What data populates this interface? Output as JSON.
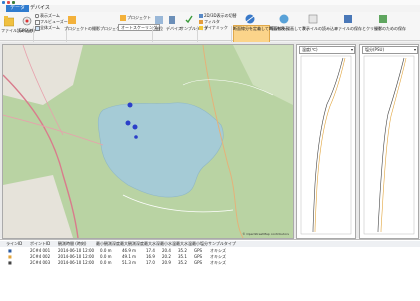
{
  "menu": {
    "items": [
      {
        "label": "データ",
        "active": true
      },
      {
        "label": "デバイス",
        "active": false
      }
    ]
  },
  "ribbon": {
    "buttons": {
      "file_input": "ファイル読み込み",
      "gps_output": "GPS出力",
      "zoom_in": "表示ズーム",
      "zoom_full": "フルビューズーム",
      "zoom_all": "全体ズーム",
      "project": "プロジェクトの撮影プロジェクトを確認する",
      "project_btn": "プロジェクト",
      "unit": "単位",
      "device": "デバイス",
      "sample_type": "サンプルタイプ",
      "select_combo": "オートスケーリング",
      "display_profile": "2D/3D表示の切替",
      "filter": "フィルタ",
      "wrap": "ダイナミック",
      "line_profile": "断面線分を定義して断面を表示",
      "contour": "等深線を描画して表示",
      "file_load": "ファイルの読み込み",
      "file_save": "ファイルの保存とクリック",
      "graph_save": "撮影のための保存"
    },
    "sections": [
      "表示",
      "プロジェクト",
      "フィルタ",
      "ツール",
      "ダウン"
    ]
  },
  "map": {
    "icon_labels": [
      "map-marker"
    ],
    "attribution": "© OpenStreetMap contributors"
  },
  "panels": [
    {
      "header": "温度(℃)"
    },
    {
      "header": "塩分(PSU)"
    }
  ],
  "table": {
    "headers": [
      "ラインID",
      "ポイントID",
      "観測時間 (時刻)",
      "最小観測深度",
      "最大観測深度",
      "最大水深",
      "最小水温",
      "最大水温",
      "最小塩分",
      "サンプルタイプ"
    ],
    "rows": [
      [
        "■",
        "2C#4 001",
        "2014-06-10 12:00",
        "0.0 m",
        "46.9 m",
        "17.4",
        "20.4",
        "35.2",
        "GPS",
        "オキシズ"
      ],
      [
        "■",
        "2C#4 002",
        "2014-06-10 12:00",
        "0.0 m",
        "49.1 m",
        "16.9",
        "20.2",
        "35.1",
        "GPS",
        "オキシズ"
      ],
      [
        "■",
        "2C#4 003",
        "2014-06-10 12:00",
        "0.0 m",
        "51.3 m",
        "17.0",
        "20.9",
        "35.2",
        "GPS",
        "オキシズ"
      ]
    ]
  }
}
